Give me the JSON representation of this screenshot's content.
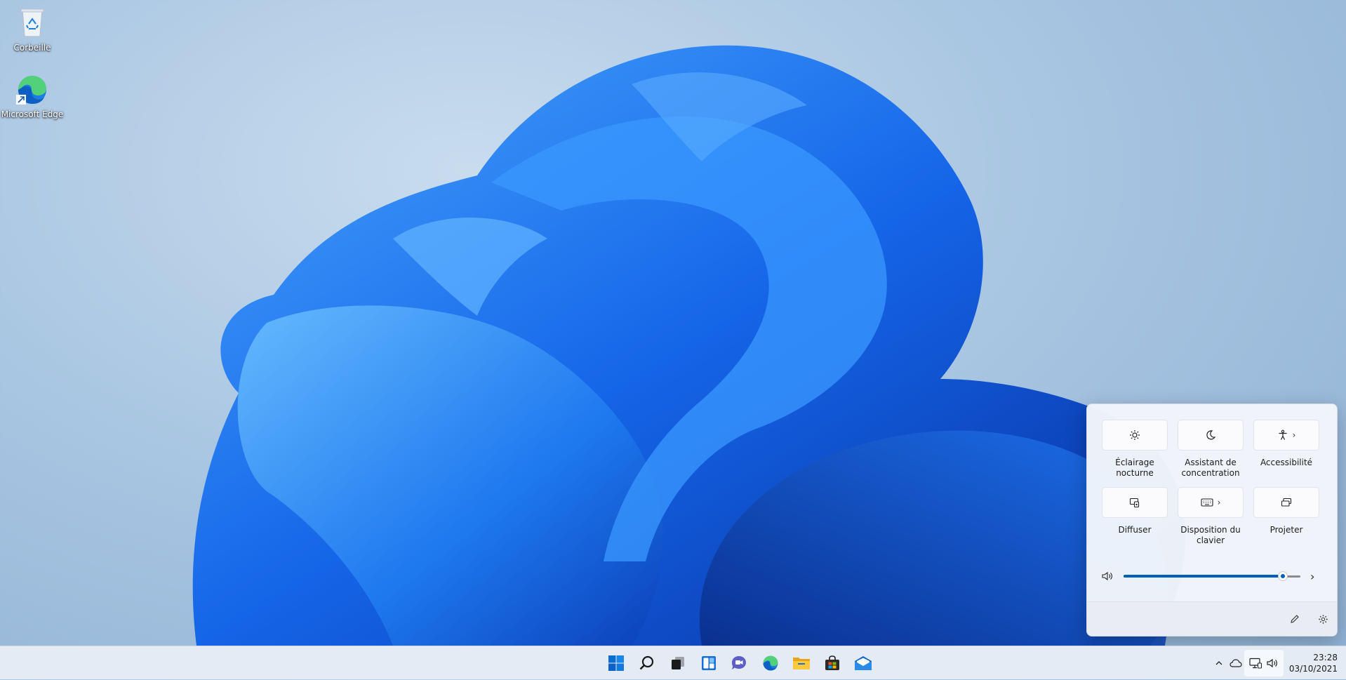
{
  "desktop": {
    "icons": [
      {
        "label": "Corbeille",
        "icon": "recycle-bin-icon"
      },
      {
        "label": "Microsoft Edge",
        "icon": "edge-icon"
      }
    ]
  },
  "quick_settings": {
    "tiles": [
      {
        "label": "Éclairage nocturne",
        "icon": "brightness-icon",
        "has_chevron": false
      },
      {
        "label": "Assistant de concentration",
        "icon": "moon-icon",
        "has_chevron": false
      },
      {
        "label": "Accessibilité",
        "icon": "accessibility-icon",
        "has_chevron": true
      },
      {
        "label": "Diffuser",
        "icon": "cast-icon",
        "has_chevron": false
      },
      {
        "label": "Disposition du clavier",
        "icon": "keyboard-icon",
        "has_chevron": true
      },
      {
        "label": "Projeter",
        "icon": "project-icon",
        "has_chevron": false
      }
    ],
    "volume": {
      "level": 0.9,
      "icon": "speaker-icon"
    },
    "footer": {
      "edit_icon": "pencil-icon",
      "settings_icon": "gear-icon"
    }
  },
  "taskbar": {
    "apps": [
      "start-icon",
      "search-icon",
      "task-view-icon",
      "widgets-icon",
      "teams-chat-icon",
      "edge-icon",
      "file-explorer-icon",
      "store-icon",
      "mail-icon"
    ],
    "tray_icons": [
      "chevron-up-icon",
      "onedrive-icon",
      "network-icon",
      "volume-icon"
    ],
    "clock": {
      "time": "23:28",
      "date": "03/10/2021"
    }
  },
  "colors": {
    "accent": "#005fb8",
    "taskbar": "#e4ebf4"
  }
}
